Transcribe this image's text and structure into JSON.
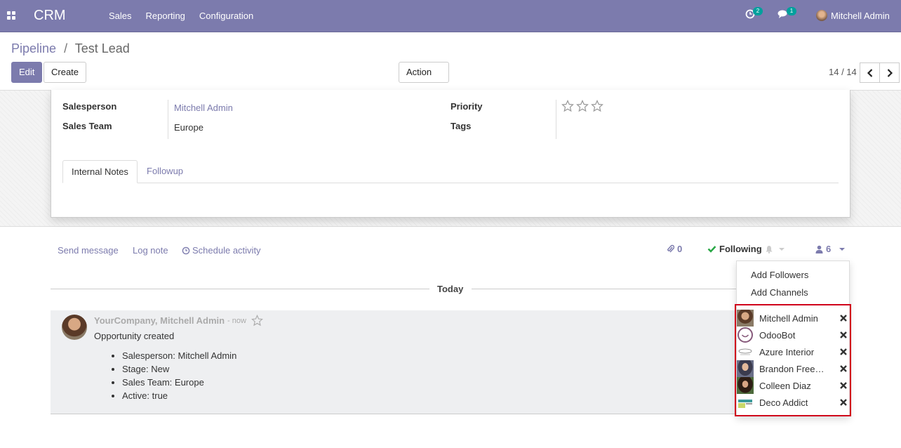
{
  "navbar": {
    "brand": "CRM",
    "menu": [
      "Sales",
      "Reporting",
      "Configuration"
    ],
    "activity_count": "2",
    "message_count": "1",
    "user_name": "Mitchell Admin"
  },
  "breadcrumb": {
    "parent": "Pipeline",
    "separator": "/",
    "current": "Test Lead"
  },
  "buttons": {
    "edit": "Edit",
    "create": "Create",
    "action": "Action"
  },
  "pager": {
    "value": "14 / 14"
  },
  "form": {
    "salesperson_label": "Salesperson",
    "salesperson_value": "Mitchell Admin",
    "sales_team_label": "Sales Team",
    "sales_team_value": "Europe",
    "priority_label": "Priority",
    "tags_label": "Tags",
    "priority_stars": 0,
    "tabs": [
      "Internal Notes",
      "Followup"
    ]
  },
  "chatter": {
    "send_message": "Send message",
    "log_note": "Log note",
    "schedule_activity": "Schedule activity",
    "attachments_count": "0",
    "following_label": "Following",
    "followers_count": "6",
    "today_label": "Today",
    "message": {
      "author": "YourCompany, Mitchell Admin",
      "time": "- now",
      "body": "Opportunity created",
      "tracking": [
        "Salesperson: Mitchell Admin",
        "Stage: New",
        "Sales Team: Europe",
        "Active: true"
      ]
    }
  },
  "followers_dropdown": {
    "add_followers": "Add Followers",
    "add_channels": "Add Channels",
    "followers": [
      "Mitchell Admin",
      "OdooBot",
      "Azure Interior",
      "Brandon Freeman",
      "Colleen Diaz",
      "Deco Addict"
    ]
  },
  "colors": {
    "brand": "#7c7bad",
    "teal": "#00a09d",
    "success": "#28a745",
    "highlight": "#d0021b"
  }
}
